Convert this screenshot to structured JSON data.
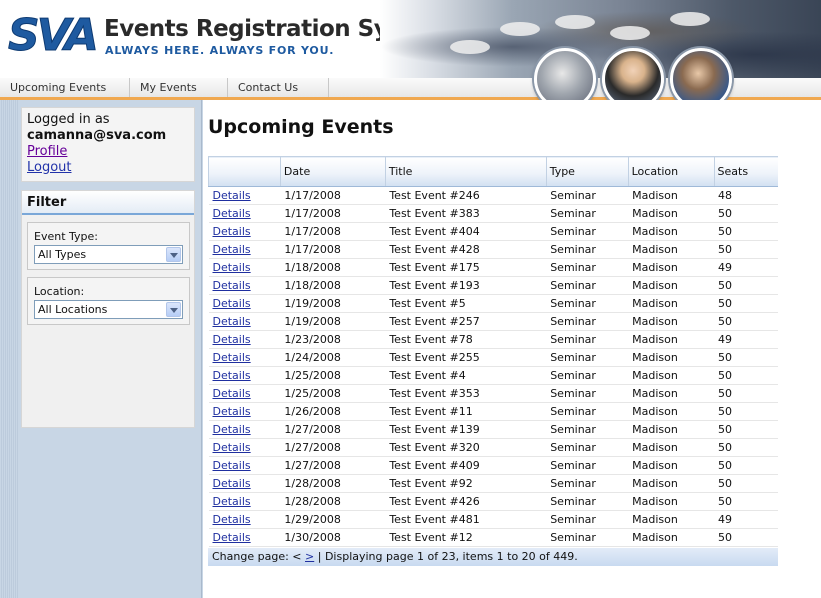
{
  "header": {
    "logo_text": "SVA",
    "title": "Events Registration System",
    "tagline": "ALWAYS HERE. ALWAYS FOR YOU."
  },
  "nav": {
    "items": [
      {
        "label": "Upcoming Events"
      },
      {
        "label": "My Events"
      },
      {
        "label": "Contact Us"
      }
    ]
  },
  "sidebar": {
    "login": {
      "label": "Logged in as",
      "user": "camanna@sva.com",
      "profile_link": "Profile",
      "logout_link": "Logout"
    },
    "filter": {
      "title": "Filter",
      "event_type_label": "Event Type:",
      "event_type_value": "All Types",
      "location_label": "Location:",
      "location_value": "All Locations"
    }
  },
  "main": {
    "title": "Upcoming Events",
    "columns": [
      "",
      "Date",
      "Title",
      "Type",
      "Location",
      "Seats"
    ],
    "link_label": "Details",
    "rows": [
      {
        "date": "1/17/2008",
        "title": "Test Event #246",
        "type": "Seminar",
        "location": "Madison",
        "seats": "48"
      },
      {
        "date": "1/17/2008",
        "title": "Test Event #383",
        "type": "Seminar",
        "location": "Madison",
        "seats": "50"
      },
      {
        "date": "1/17/2008",
        "title": "Test Event #404",
        "type": "Seminar",
        "location": "Madison",
        "seats": "50"
      },
      {
        "date": "1/17/2008",
        "title": "Test Event #428",
        "type": "Seminar",
        "location": "Madison",
        "seats": "50"
      },
      {
        "date": "1/18/2008",
        "title": "Test Event #175",
        "type": "Seminar",
        "location": "Madison",
        "seats": "49"
      },
      {
        "date": "1/18/2008",
        "title": "Test Event #193",
        "type": "Seminar",
        "location": "Madison",
        "seats": "50"
      },
      {
        "date": "1/19/2008",
        "title": "Test Event #5",
        "type": "Seminar",
        "location": "Madison",
        "seats": "50"
      },
      {
        "date": "1/19/2008",
        "title": "Test Event #257",
        "type": "Seminar",
        "location": "Madison",
        "seats": "50"
      },
      {
        "date": "1/23/2008",
        "title": "Test Event #78",
        "type": "Seminar",
        "location": "Madison",
        "seats": "49"
      },
      {
        "date": "1/24/2008",
        "title": "Test Event #255",
        "type": "Seminar",
        "location": "Madison",
        "seats": "50"
      },
      {
        "date": "1/25/2008",
        "title": "Test Event #4",
        "type": "Seminar",
        "location": "Madison",
        "seats": "50"
      },
      {
        "date": "1/25/2008",
        "title": "Test Event #353",
        "type": "Seminar",
        "location": "Madison",
        "seats": "50"
      },
      {
        "date": "1/26/2008",
        "title": "Test Event #11",
        "type": "Seminar",
        "location": "Madison",
        "seats": "50"
      },
      {
        "date": "1/27/2008",
        "title": "Test Event #139",
        "type": "Seminar",
        "location": "Madison",
        "seats": "50"
      },
      {
        "date": "1/27/2008",
        "title": "Test Event #320",
        "type": "Seminar",
        "location": "Madison",
        "seats": "50"
      },
      {
        "date": "1/27/2008",
        "title": "Test Event #409",
        "type": "Seminar",
        "location": "Madison",
        "seats": "50"
      },
      {
        "date": "1/28/2008",
        "title": "Test Event #92",
        "type": "Seminar",
        "location": "Madison",
        "seats": "50"
      },
      {
        "date": "1/28/2008",
        "title": "Test Event #426",
        "type": "Seminar",
        "location": "Madison",
        "seats": "50"
      },
      {
        "date": "1/29/2008",
        "title": "Test Event #481",
        "type": "Seminar",
        "location": "Madison",
        "seats": "49"
      },
      {
        "date": "1/30/2008",
        "title": "Test Event #12",
        "type": "Seminar",
        "location": "Madison",
        "seats": "50"
      }
    ],
    "pager": {
      "label": "Change page:",
      "prev": "<",
      "next": ">",
      "separator": "|",
      "status": "Displaying page 1 of 23, items 1 to 20 of 449."
    }
  },
  "colors": {
    "brand_blue": "#1e5aa0",
    "nav_accent": "#f0a850",
    "sidebar_bg": "#c8d6e5",
    "link": "#1f2fa0",
    "visited_link": "#660099"
  },
  "icons": {
    "dropdown": "chevron-down-icon"
  }
}
